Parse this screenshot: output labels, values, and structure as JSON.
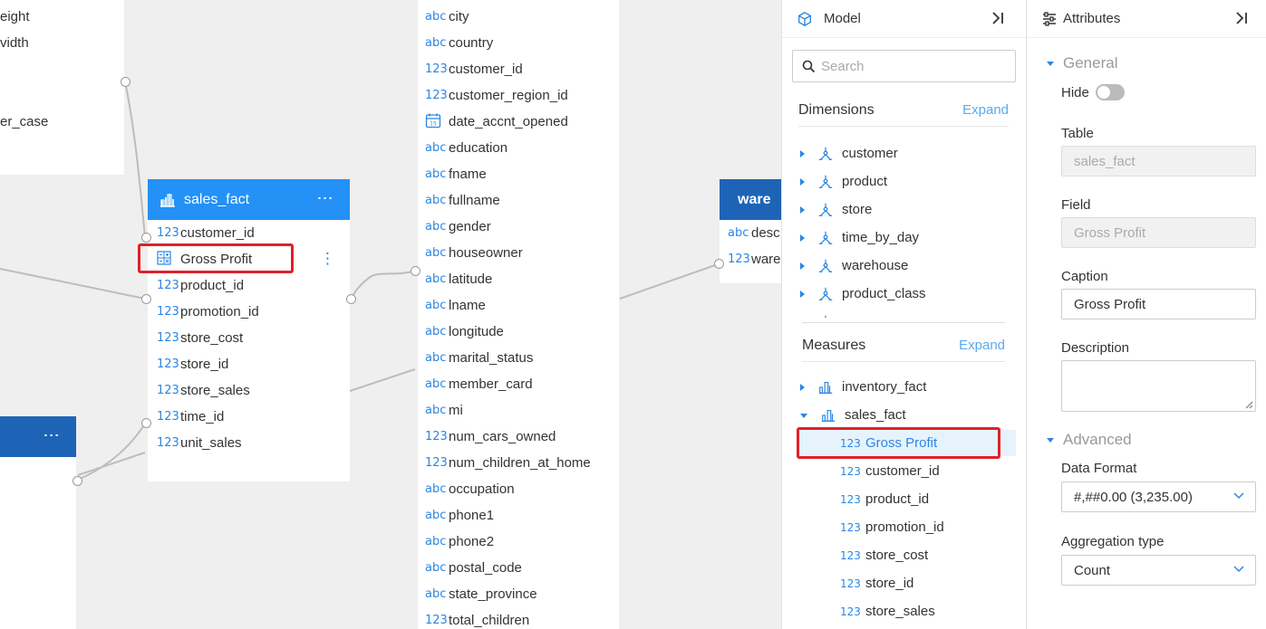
{
  "left_table": {
    "visible_fragments": [
      "eight",
      "vidth",
      "er_case"
    ]
  },
  "sales_fact_card": {
    "title": "sales_fact",
    "fields": [
      {
        "type": "123",
        "name": "customer_id"
      },
      {
        "type": "calc",
        "name": "Gross Profit"
      },
      {
        "type": "123",
        "name": "product_id"
      },
      {
        "type": "123",
        "name": "promotion_id"
      },
      {
        "type": "123",
        "name": "store_cost"
      },
      {
        "type": "123",
        "name": "store_id"
      },
      {
        "type": "123",
        "name": "store_sales"
      },
      {
        "type": "123",
        "name": "time_id"
      },
      {
        "type": "123",
        "name": "unit_sales"
      }
    ]
  },
  "customer_card": {
    "fields": [
      {
        "type": "abc",
        "name": "city"
      },
      {
        "type": "abc",
        "name": "country"
      },
      {
        "type": "123",
        "name": "customer_id"
      },
      {
        "type": "123",
        "name": "customer_region_id"
      },
      {
        "type": "date",
        "name": "date_accnt_opened"
      },
      {
        "type": "abc",
        "name": "education"
      },
      {
        "type": "abc",
        "name": "fname"
      },
      {
        "type": "abc",
        "name": "fullname"
      },
      {
        "type": "abc",
        "name": "gender"
      },
      {
        "type": "abc",
        "name": "houseowner"
      },
      {
        "type": "abc",
        "name": "latitude"
      },
      {
        "type": "abc",
        "name": "lname"
      },
      {
        "type": "abc",
        "name": "longitude"
      },
      {
        "type": "abc",
        "name": "marital_status"
      },
      {
        "type": "abc",
        "name": "member_card"
      },
      {
        "type": "abc",
        "name": "mi"
      },
      {
        "type": "123",
        "name": "num_cars_owned"
      },
      {
        "type": "123",
        "name": "num_children_at_home"
      },
      {
        "type": "abc",
        "name": "occupation"
      },
      {
        "type": "abc",
        "name": "phone1"
      },
      {
        "type": "abc",
        "name": "phone2"
      },
      {
        "type": "abc",
        "name": "postal_code"
      },
      {
        "type": "abc",
        "name": "state_province"
      },
      {
        "type": "123",
        "name": "total_children"
      }
    ]
  },
  "warehouse_card": {
    "title": "ware",
    "fields": [
      {
        "type": "abc",
        "name": "desc"
      },
      {
        "type": "123",
        "name": "ware"
      }
    ]
  },
  "type_labels": {
    "abc": "abc",
    "num": "123"
  },
  "model_panel": {
    "title": "Model",
    "search_placeholder": "Search",
    "dimensions_label": "Dimensions",
    "measures_label": "Measures",
    "expand_label": "Expand",
    "dimensions": [
      "customer",
      "product",
      "store",
      "time_by_day",
      "warehouse",
      "product_class"
    ],
    "measure_groups": [
      "inventory_fact",
      "sales_fact"
    ],
    "sales_fact_measures": [
      {
        "type": "123",
        "name": "Gross Profit",
        "selected": true
      },
      {
        "type": "123",
        "name": "customer_id"
      },
      {
        "type": "123",
        "name": "product_id"
      },
      {
        "type": "123",
        "name": "promotion_id"
      },
      {
        "type": "123",
        "name": "store_cost"
      },
      {
        "type": "123",
        "name": "store_id"
      },
      {
        "type": "123",
        "name": "store_sales"
      }
    ]
  },
  "attributes_panel": {
    "title": "Attributes",
    "general_label": "General",
    "hide_label": "Hide",
    "hide_value": false,
    "table_label": "Table",
    "table_value": "sales_fact",
    "field_label": "Field",
    "field_value": "Gross Profit",
    "caption_label": "Caption",
    "caption_value": "Gross Profit",
    "description_label": "Description",
    "description_value": "",
    "advanced_label": "Advanced",
    "data_format_label": "Data Format",
    "data_format_value": "#,##0.00 (3,235.00)",
    "aggregation_label": "Aggregation type",
    "aggregation_value": "Count"
  },
  "colors": {
    "header_blue": "#2491f7",
    "header_dark": "#1e64b6",
    "type_blue": "#2b86e3",
    "highlight_red": "#e0202a"
  }
}
